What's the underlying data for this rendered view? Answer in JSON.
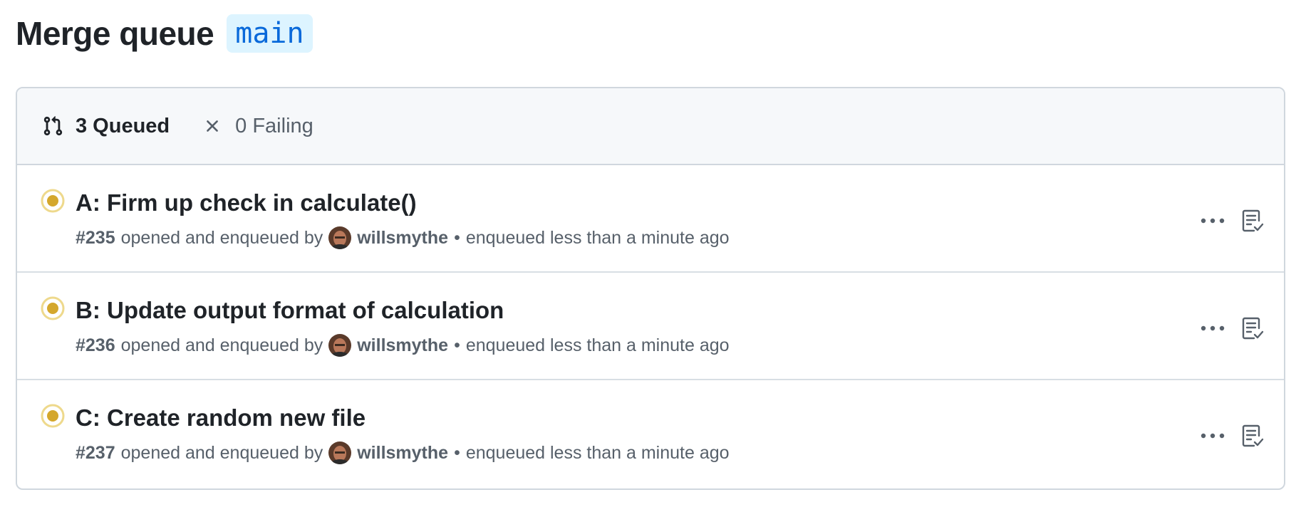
{
  "page": {
    "title": "Merge queue",
    "branch": "main"
  },
  "filters": {
    "queued_label": "3 Queued",
    "failing_label": "0 Failing"
  },
  "entries": [
    {
      "title": "A: Firm up check in calculate()",
      "number": "#235",
      "opened_text": "opened and enqueued by",
      "user": "willsmythe",
      "separator": "•",
      "enqueued_text": "enqueued less than a minute ago",
      "status_icon": "pending-dot-icon"
    },
    {
      "title": "B: Update output format of calculation",
      "number": "#236",
      "opened_text": "opened and enqueued by",
      "user": "willsmythe",
      "separator": "•",
      "enqueued_text": "enqueued less than a minute ago",
      "status_icon": "pending-dot-icon"
    },
    {
      "title": "C: Create random new file",
      "number": "#237",
      "opened_text": "opened and enqueued by",
      "user": "willsmythe",
      "separator": "•",
      "enqueued_text": "enqueued less than a minute ago",
      "status_icon": "pending-dot-icon"
    }
  ],
  "colors": {
    "pending": "#d4a72c",
    "branch_bg": "#ddf4ff",
    "branch_fg": "#0969da",
    "border": "#d0d7de",
    "header_bg": "#f6f8fa",
    "muted": "#57606a"
  },
  "icons": {
    "queued": "git-pull-request-icon",
    "failing": "x-icon",
    "more": "kebab-horizontal-icon",
    "checks": "checklist-icon"
  }
}
